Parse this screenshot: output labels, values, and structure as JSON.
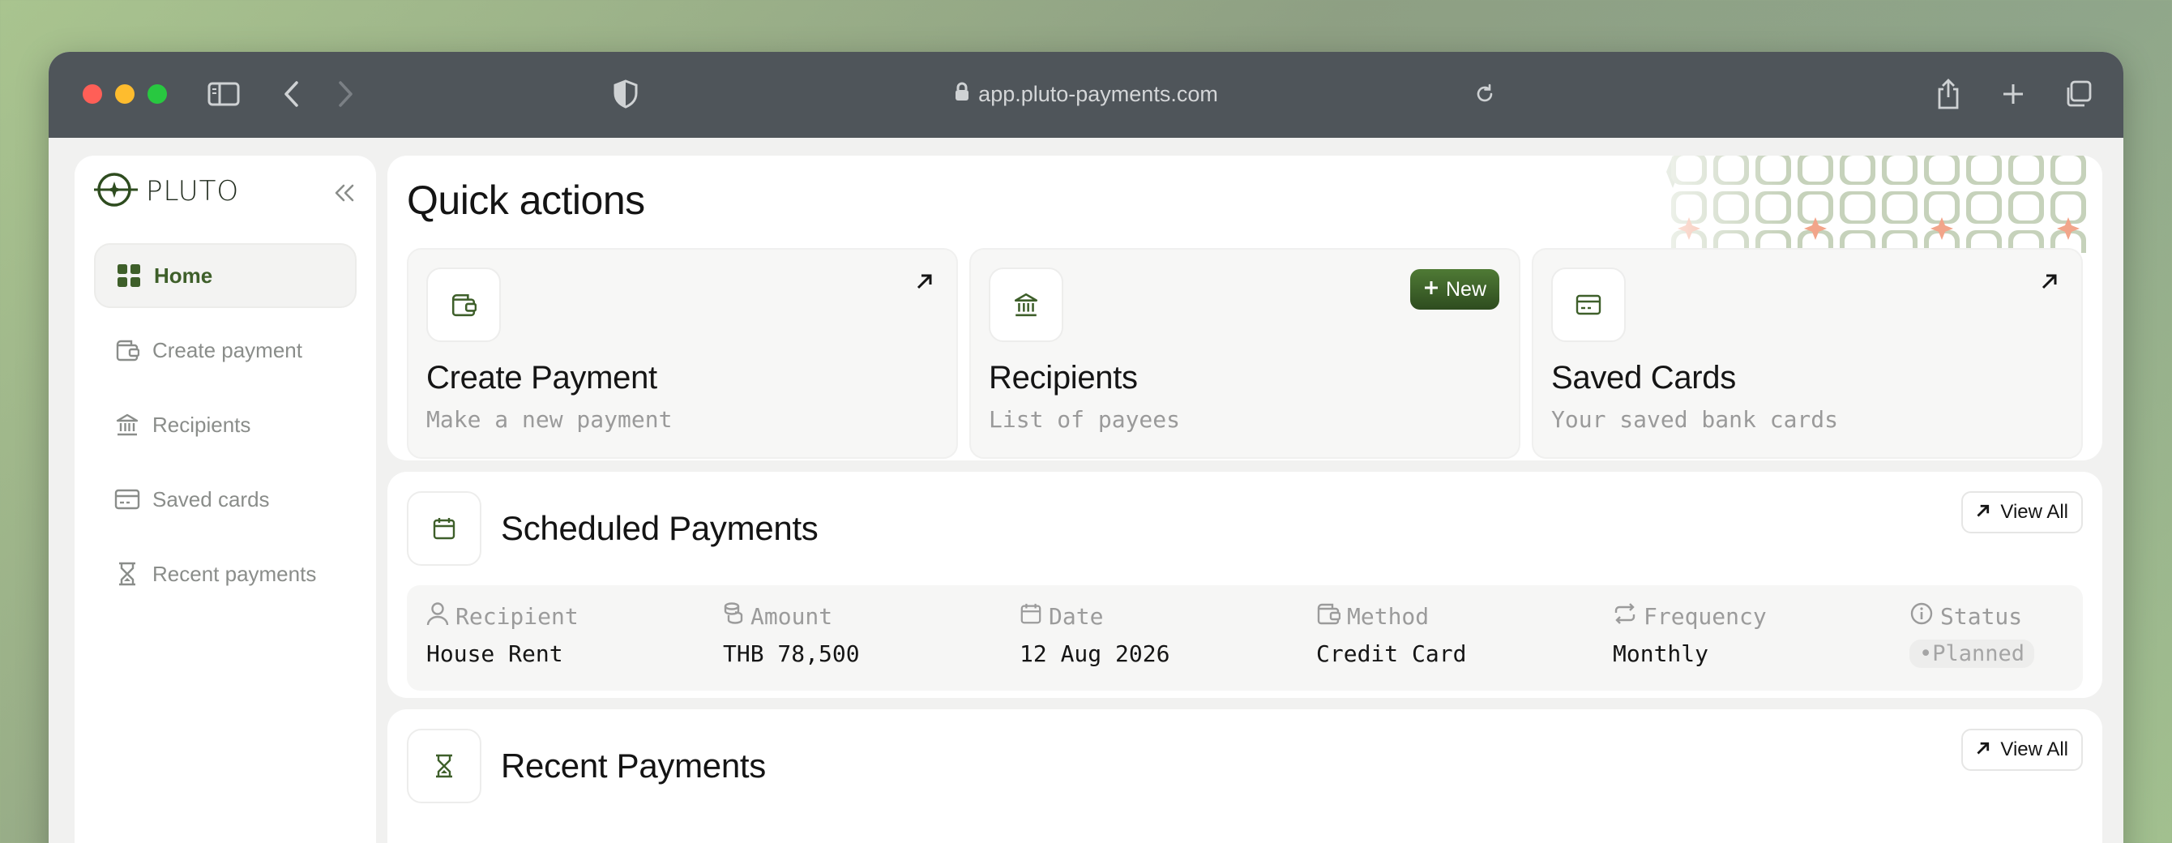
{
  "browser": {
    "url": "app.pluto-payments.com"
  },
  "sidebar": {
    "logo_text": "PLUTO",
    "items": [
      {
        "label": "Home",
        "icon": "grid-icon",
        "active": true
      },
      {
        "label": "Create payment",
        "icon": "wallet-icon"
      },
      {
        "label": "Recipients",
        "icon": "bank-icon"
      },
      {
        "label": "Saved cards",
        "icon": "card-icon"
      },
      {
        "label": "Recent payments",
        "icon": "hourglass-icon"
      }
    ]
  },
  "quick_actions": {
    "title": "Quick actions",
    "cards": [
      {
        "title": "Create Payment",
        "subtitle": "Make a new payment",
        "icon": "wallet-icon"
      },
      {
        "title": "Recipients",
        "subtitle": "List of payees",
        "icon": "bank-icon",
        "badge": "New"
      },
      {
        "title": "Saved Cards",
        "subtitle": "Your saved bank cards",
        "icon": "card-icon"
      }
    ]
  },
  "scheduled": {
    "title": "Scheduled Payments",
    "view_all": "View All",
    "columns": [
      "Recipient",
      "Amount",
      "Date",
      "Method",
      "Frequency",
      "Status"
    ],
    "row": {
      "recipient": "House Rent",
      "amount": "THB 78,500",
      "date": "12 Aug 2026",
      "method": "Credit Card",
      "frequency": "Monthly",
      "status": "•Planned"
    }
  },
  "recent": {
    "title": "Recent Payments",
    "view_all": "View All"
  },
  "colors": {
    "brand": "#3e5f2a",
    "accent_dark": "#2e4c1f",
    "titlebar": "#4f555a"
  }
}
